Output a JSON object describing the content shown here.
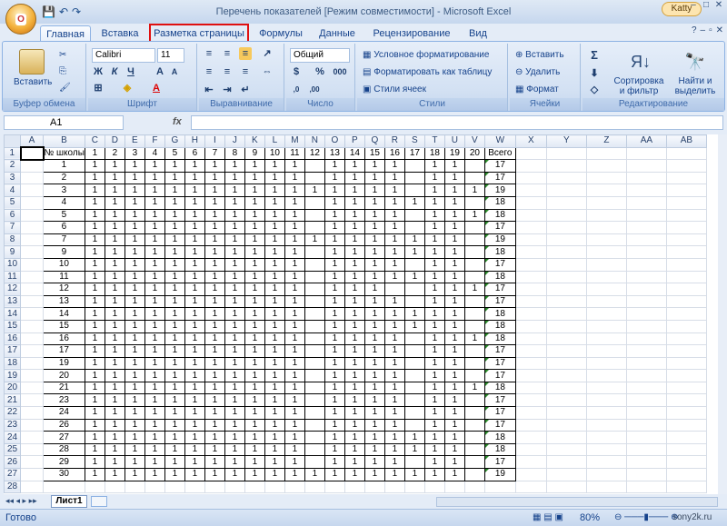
{
  "window": {
    "title": "Перечень показателей  [Режим совместимости]  -  Microsoft Excel",
    "user": "Katty",
    "office_button_label": "Office"
  },
  "tabs": [
    "Главная",
    "Вставка",
    "Разметка страницы",
    "Формулы",
    "Данные",
    "Рецензирование",
    "Вид"
  ],
  "ribbon": {
    "clipboard": {
      "label": "Буфер обмена",
      "paste": "Вставить"
    },
    "font": {
      "label": "Шрифт",
      "name": "Calibri",
      "size": "11",
      "bold": "Ж",
      "italic": "К",
      "underline": "Ч"
    },
    "alignment": {
      "label": "Выравнивание"
    },
    "number": {
      "label": "Число",
      "format": "Общий",
      "percent": "%",
      "thousands": "000"
    },
    "styles": {
      "label": "Стили",
      "conditional": "Условное форматирование",
      "as_table": "Форматировать как таблицу",
      "cell_styles": "Стили ячеек"
    },
    "cells": {
      "label": "Ячейки",
      "insert": "Вставить",
      "delete": "Удалить",
      "format": "Формат"
    },
    "editing": {
      "label": "Редактирование",
      "sort": "Сортировка и фильтр",
      "find": "Найти и выделить"
    }
  },
  "formula_bar": {
    "name_box": "A1",
    "fx": "fx",
    "formula": ""
  },
  "columns": [
    "A",
    "B",
    "C",
    "D",
    "E",
    "F",
    "G",
    "H",
    "I",
    "J",
    "K",
    "L",
    "M",
    "N",
    "O",
    "P",
    "Q",
    "R",
    "S",
    "T",
    "U",
    "V",
    "W",
    "X",
    "Y",
    "Z",
    "AA",
    "AB"
  ],
  "header_row": [
    "№ школы",
    "1",
    "2",
    "3",
    "4",
    "5",
    "6",
    "7",
    "8",
    "9",
    "10",
    "11",
    "12",
    "13",
    "14",
    "15",
    "16",
    "17",
    "18",
    "19",
    "20",
    "Всего"
  ],
  "rows": [
    {
      "school": "1",
      "v": [
        "1",
        "1",
        "1",
        "1",
        "1",
        "1",
        "1",
        "1",
        "1",
        "1",
        "1",
        "",
        "1",
        "1",
        "1",
        "1",
        "",
        "1",
        "1",
        "",
        ""
      ],
      "total": "17"
    },
    {
      "school": "2",
      "v": [
        "1",
        "1",
        "1",
        "1",
        "1",
        "1",
        "1",
        "1",
        "1",
        "1",
        "1",
        "",
        "1",
        "1",
        "1",
        "1",
        "",
        "1",
        "1",
        "",
        ""
      ],
      "total": "17"
    },
    {
      "school": "3",
      "v": [
        "1",
        "1",
        "1",
        "1",
        "1",
        "1",
        "1",
        "1",
        "1",
        "1",
        "1",
        "1",
        "1",
        "1",
        "1",
        "1",
        "",
        "1",
        "1",
        "1",
        ""
      ],
      "total": "19"
    },
    {
      "school": "4",
      "v": [
        "1",
        "1",
        "1",
        "1",
        "1",
        "1",
        "1",
        "1",
        "1",
        "1",
        "1",
        "",
        "1",
        "1",
        "1",
        "1",
        "1",
        "1",
        "1",
        "",
        ""
      ],
      "total": "18"
    },
    {
      "school": "5",
      "v": [
        "1",
        "1",
        "1",
        "1",
        "1",
        "1",
        "1",
        "1",
        "1",
        "1",
        "1",
        "",
        "1",
        "1",
        "1",
        "1",
        "",
        "1",
        "1",
        "1",
        ""
      ],
      "total": "18"
    },
    {
      "school": "6",
      "v": [
        "1",
        "1",
        "1",
        "1",
        "1",
        "1",
        "1",
        "1",
        "1",
        "1",
        "1",
        "",
        "1",
        "1",
        "1",
        "1",
        "",
        "1",
        "1",
        "",
        ""
      ],
      "total": "17"
    },
    {
      "school": "7",
      "v": [
        "1",
        "1",
        "1",
        "1",
        "1",
        "1",
        "1",
        "1",
        "1",
        "1",
        "1",
        "1",
        "1",
        "1",
        "1",
        "1",
        "1",
        "1",
        "1",
        "",
        ""
      ],
      "total": "19"
    },
    {
      "school": "9",
      "v": [
        "1",
        "1",
        "1",
        "1",
        "1",
        "1",
        "1",
        "1",
        "1",
        "1",
        "1",
        "",
        "1",
        "1",
        "1",
        "1",
        "1",
        "1",
        "1",
        "",
        ""
      ],
      "total": "18"
    },
    {
      "school": "10",
      "v": [
        "1",
        "1",
        "1",
        "1",
        "1",
        "1",
        "1",
        "1",
        "1",
        "1",
        "1",
        "",
        "1",
        "1",
        "1",
        "1",
        "",
        "1",
        "1",
        "",
        ""
      ],
      "total": "17"
    },
    {
      "school": "11",
      "v": [
        "1",
        "1",
        "1",
        "1",
        "1",
        "1",
        "1",
        "1",
        "1",
        "1",
        "1",
        "",
        "1",
        "1",
        "1",
        "1",
        "1",
        "1",
        "1",
        "",
        ""
      ],
      "total": "18"
    },
    {
      "school": "12",
      "v": [
        "1",
        "1",
        "1",
        "1",
        "1",
        "1",
        "1",
        "1",
        "1",
        "1",
        "1",
        "",
        "1",
        "1",
        "1",
        "",
        "",
        "1",
        "1",
        "1",
        ""
      ],
      "total": "17"
    },
    {
      "school": "13",
      "v": [
        "1",
        "1",
        "1",
        "1",
        "1",
        "1",
        "1",
        "1",
        "1",
        "1",
        "1",
        "",
        "1",
        "1",
        "1",
        "1",
        "",
        "1",
        "1",
        "",
        ""
      ],
      "total": "17"
    },
    {
      "school": "14",
      "v": [
        "1",
        "1",
        "1",
        "1",
        "1",
        "1",
        "1",
        "1",
        "1",
        "1",
        "1",
        "",
        "1",
        "1",
        "1",
        "1",
        "1",
        "1",
        "1",
        "",
        ""
      ],
      "total": "18"
    },
    {
      "school": "15",
      "v": [
        "1",
        "1",
        "1",
        "1",
        "1",
        "1",
        "1",
        "1",
        "1",
        "1",
        "1",
        "",
        "1",
        "1",
        "1",
        "1",
        "1",
        "1",
        "1",
        "",
        ""
      ],
      "total": "18"
    },
    {
      "school": "16",
      "v": [
        "1",
        "1",
        "1",
        "1",
        "1",
        "1",
        "1",
        "1",
        "1",
        "1",
        "1",
        "",
        "1",
        "1",
        "1",
        "1",
        "",
        "1",
        "1",
        "1",
        ""
      ],
      "total": "18"
    },
    {
      "school": "17",
      "v": [
        "1",
        "1",
        "1",
        "1",
        "1",
        "1",
        "1",
        "1",
        "1",
        "1",
        "1",
        "",
        "1",
        "1",
        "1",
        "1",
        "",
        "1",
        "1",
        "",
        ""
      ],
      "total": "17"
    },
    {
      "school": "19",
      "v": [
        "1",
        "1",
        "1",
        "1",
        "1",
        "1",
        "1",
        "1",
        "1",
        "1",
        "1",
        "",
        "1",
        "1",
        "1",
        "1",
        "",
        "1",
        "1",
        "",
        ""
      ],
      "total": "17"
    },
    {
      "school": "20",
      "v": [
        "1",
        "1",
        "1",
        "1",
        "1",
        "1",
        "1",
        "1",
        "1",
        "1",
        "1",
        "",
        "1",
        "1",
        "1",
        "1",
        "",
        "1",
        "1",
        "",
        ""
      ],
      "total": "17"
    },
    {
      "school": "21",
      "v": [
        "1",
        "1",
        "1",
        "1",
        "1",
        "1",
        "1",
        "1",
        "1",
        "1",
        "1",
        "",
        "1",
        "1",
        "1",
        "1",
        "",
        "1",
        "1",
        "1",
        ""
      ],
      "total": "18"
    },
    {
      "school": "23",
      "v": [
        "1",
        "1",
        "1",
        "1",
        "1",
        "1",
        "1",
        "1",
        "1",
        "1",
        "1",
        "",
        "1",
        "1",
        "1",
        "1",
        "",
        "1",
        "1",
        "",
        ""
      ],
      "total": "17"
    },
    {
      "school": "24",
      "v": [
        "1",
        "1",
        "1",
        "1",
        "1",
        "1",
        "1",
        "1",
        "1",
        "1",
        "1",
        "",
        "1",
        "1",
        "1",
        "1",
        "",
        "1",
        "1",
        "",
        ""
      ],
      "total": "17"
    },
    {
      "school": "26",
      "v": [
        "1",
        "1",
        "1",
        "1",
        "1",
        "1",
        "1",
        "1",
        "1",
        "1",
        "1",
        "",
        "1",
        "1",
        "1",
        "1",
        "",
        "1",
        "1",
        "",
        ""
      ],
      "total": "17"
    },
    {
      "school": "27",
      "v": [
        "1",
        "1",
        "1",
        "1",
        "1",
        "1",
        "1",
        "1",
        "1",
        "1",
        "1",
        "",
        "1",
        "1",
        "1",
        "1",
        "1",
        "1",
        "1",
        "",
        ""
      ],
      "total": "18"
    },
    {
      "school": "28",
      "v": [
        "1",
        "1",
        "1",
        "1",
        "1",
        "1",
        "1",
        "1",
        "1",
        "1",
        "1",
        "",
        "1",
        "1",
        "1",
        "1",
        "1",
        "1",
        "1",
        "",
        ""
      ],
      "total": "18"
    },
    {
      "school": "29",
      "v": [
        "1",
        "1",
        "1",
        "1",
        "1",
        "1",
        "1",
        "1",
        "1",
        "1",
        "1",
        "",
        "1",
        "1",
        "1",
        "1",
        "",
        "1",
        "1",
        "",
        ""
      ],
      "total": "17"
    },
    {
      "school": "30",
      "v": [
        "1",
        "1",
        "1",
        "1",
        "1",
        "1",
        "1",
        "1",
        "1",
        "1",
        "1",
        "1",
        "1",
        "1",
        "1",
        "1",
        "1",
        "1",
        "1",
        "",
        ""
      ],
      "total": "19"
    }
  ],
  "row_numbers": [
    "1",
    "2",
    "3",
    "4",
    "5",
    "6",
    "7",
    "8",
    "9",
    "10",
    "11",
    "12",
    "13",
    "14",
    "15",
    "16",
    "17",
    "18",
    "19",
    "20",
    "21",
    "22",
    "23",
    "24",
    "25",
    "26",
    "27",
    "28"
  ],
  "sheet_tab": "Лист1",
  "status": {
    "ready": "Готово",
    "zoom": "80%",
    "watermark": "sony2k.ru"
  },
  "colors": {
    "highlight_border": "#e01010",
    "ribbon_bg": "#d3e1f3",
    "accent": "#15428b"
  }
}
